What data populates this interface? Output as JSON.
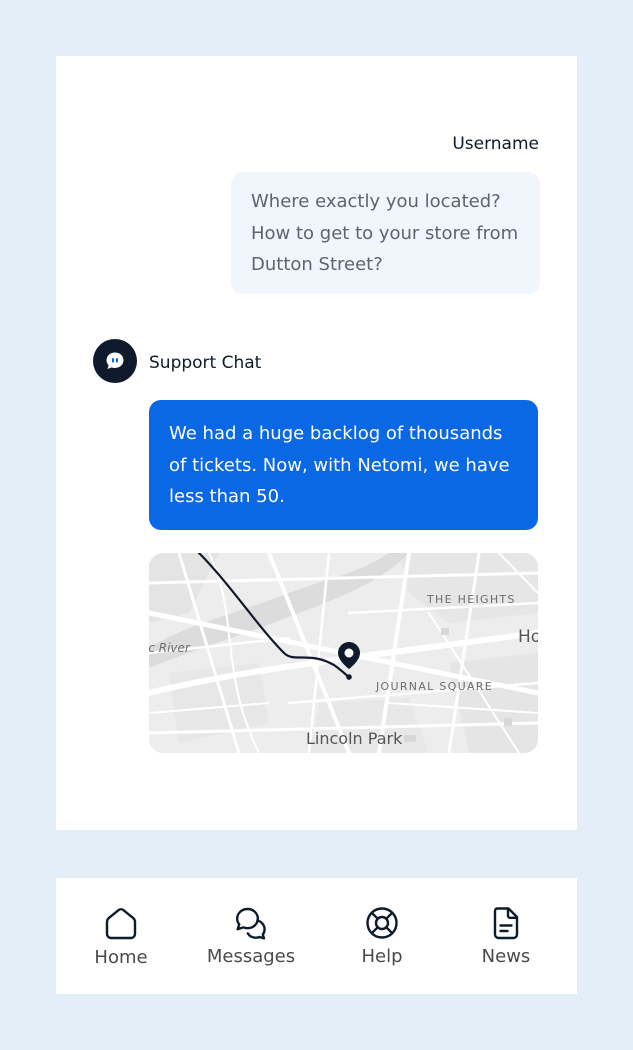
{
  "chat": {
    "username": "Username",
    "user_message": "Where exactly you located?\nHow to get to your store from\nDutton Street?",
    "agent_name": "Support Chat",
    "agent_message": "We had a huge backlog of thousands\nof tickets. Now, with Netomi, we have\nless than 50.",
    "map": {
      "labels": {
        "the_heights": "THE HEIGHTS",
        "journal_square": "JOURNAL SQUARE",
        "river": "ic River",
        "lincoln_park": "Lincoln Park",
        "ho": "Ho"
      }
    }
  },
  "nav": {
    "home": "Home",
    "messages": "Messages",
    "help": "Help",
    "news": "News"
  },
  "colors": {
    "background": "#e4eef8",
    "user_bubble": "#f1f6fd",
    "agent_bubble": "#0a68e4",
    "avatar": "#0f1a2c"
  },
  "icons": {
    "avatar": "chat-bubble-icon",
    "home": "home-icon",
    "messages": "messages-icon",
    "help": "lifebuoy-icon",
    "news": "document-icon",
    "map_pin": "map-pin-icon"
  }
}
